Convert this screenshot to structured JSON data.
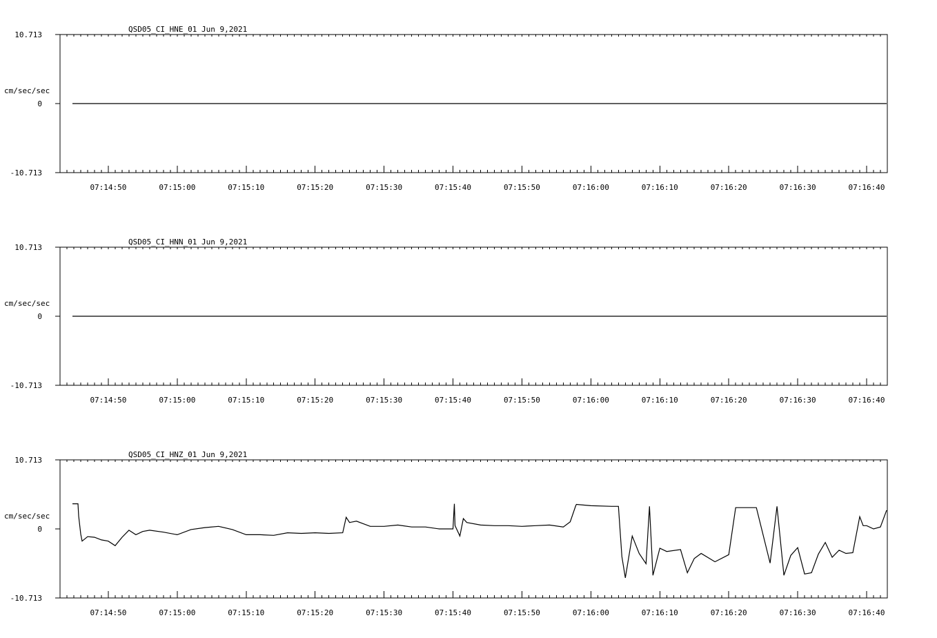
{
  "chart_data": [
    {
      "type": "line",
      "title": "QSD05_CI_HNE_01  Jun 9,2021",
      "ylabel": "cm/sec/sec",
      "ytick_labels": [
        "10.713",
        "0",
        "-10.713"
      ],
      "ylim": [
        -10.713,
        10.713
      ],
      "xlim": [
        "07:14:43",
        "07:16:43"
      ],
      "x_tick_labels": [
        "07:14:50",
        "07:15:00",
        "07:15:10",
        "07:15:20",
        "07:15:30",
        "07:15:40",
        "07:15:50",
        "07:16:00",
        "07:16:10",
        "07:16:20",
        "07:16:30",
        "07:16:40"
      ],
      "series": [
        {
          "x": [
            "07:14:44.8",
            "07:16:42.9"
          ],
          "y": [
            0,
            0
          ]
        }
      ]
    },
    {
      "type": "line",
      "title": "QSD05_CI_HNN_01  Jun 9,2021",
      "ylabel": "cm/sec/sec",
      "ytick_labels": [
        "10.713",
        "0",
        "-10.713"
      ],
      "ylim": [
        -10.713,
        10.713
      ],
      "xlim": [
        "07:14:43",
        "07:16:43"
      ],
      "x_tick_labels": [
        "07:14:50",
        "07:15:00",
        "07:15:10",
        "07:15:20",
        "07:15:30",
        "07:15:40",
        "07:15:50",
        "07:16:00",
        "07:16:10",
        "07:16:20",
        "07:16:30",
        "07:16:40"
      ],
      "series": [
        {
          "x": [
            "07:14:44.8",
            "07:15:30",
            "07:16:42.9"
          ],
          "y": [
            0,
            0,
            0
          ]
        }
      ]
    },
    {
      "type": "line",
      "title": "QSD05_CI_HNZ_01  Jun 9,2021",
      "ylabel": "cm/sec/sec",
      "ytick_labels": [
        "10.713",
        "0",
        "-10.713"
      ],
      "ylim": [
        -10.713,
        10.713
      ],
      "xlim": [
        "07:14:43",
        "07:16:43"
      ],
      "x_tick_labels": [
        "07:14:50",
        "07:15:00",
        "07:15:10",
        "07:15:20",
        "07:15:30",
        "07:15:40",
        "07:15:50",
        "07:16:00",
        "07:16:10",
        "07:16:20",
        "07:16:30",
        "07:16:40"
      ],
      "series": [
        {
          "x": [
            "07:14:44.8",
            "07:14:45.6",
            "07:14:45.7",
            "07:14:46",
            "07:14:46.2",
            "07:14:47",
            "07:14:48",
            "07:14:49",
            "07:14:50",
            "07:14:51",
            "07:14:52",
            "07:14:53",
            "07:14:54",
            "07:14:55",
            "07:14:56",
            "07:14:58",
            "07:15:00",
            "07:15:02",
            "07:15:04",
            "07:15:06",
            "07:15:08",
            "07:15:10",
            "07:15:12",
            "07:15:14",
            "07:15:16",
            "07:15:18",
            "07:15:20",
            "07:15:22",
            "07:15:24",
            "07:15:24.5",
            "07:15:25",
            "07:15:26",
            "07:15:28",
            "07:15:30",
            "07:15:32",
            "07:15:34",
            "07:15:36",
            "07:15:38",
            "07:15:40",
            "07:15:40.2",
            "07:15:40.3",
            "07:15:41",
            "07:15:41.5",
            "07:15:42",
            "07:15:44",
            "07:15:46",
            "07:15:48",
            "07:15:50",
            "07:15:52",
            "07:15:54",
            "07:15:56",
            "07:15:57",
            "07:15:57.8",
            "07:15:57.9",
            "07:16:00",
            "07:16:03",
            "07:16:04",
            "07:16:04.5",
            "07:16:05",
            "07:16:06",
            "07:16:07",
            "07:16:08",
            "07:16:08.5",
            "07:16:09",
            "07:16:10",
            "07:16:11",
            "07:16:13",
            "07:16:14",
            "07:16:15",
            "07:16:16",
            "07:16:18",
            "07:16:20",
            "07:16:21",
            "07:16:23",
            "07:16:24",
            "07:16:26",
            "07:16:27",
            "07:16:28",
            "07:16:29",
            "07:16:30",
            "07:16:31",
            "07:16:32",
            "07:16:33",
            "07:16:34",
            "07:16:35",
            "07:16:36",
            "07:16:37",
            "07:16:38",
            "07:16:39",
            "07:16:39.5",
            "07:16:40",
            "07:16:41",
            "07:16:42",
            "07:16:42.9"
          ],
          "y": [
            3.9,
            3.9,
            2.0,
            -0.8,
            -1.9,
            -1.2,
            -1.3,
            -1.7,
            -1.9,
            -2.6,
            -1.3,
            -0.2,
            -0.9,
            -0.4,
            -0.2,
            -0.5,
            -0.9,
            -0.1,
            0.2,
            0.4,
            -0.1,
            -0.9,
            -0.9,
            -1.0,
            -0.6,
            -0.7,
            -0.6,
            -0.7,
            -0.6,
            1.8,
            1.0,
            1.2,
            0.4,
            0.4,
            0.6,
            0.3,
            0.3,
            0.0,
            0.0,
            3.9,
            0.5,
            -1.1,
            1.6,
            1.0,
            0.6,
            0.5,
            0.5,
            0.4,
            0.5,
            0.6,
            0.3,
            1.1,
            3.6,
            3.8,
            3.6,
            3.5,
            3.5,
            -4.3,
            -7.6,
            -1.1,
            -3.8,
            -5.4,
            3.5,
            -7.2,
            -3.0,
            -3.5,
            -3.2,
            -6.8,
            -4.6,
            -3.8,
            -5.1,
            -4.0,
            3.3,
            3.3,
            3.3,
            -5.3,
            3.5,
            -7.2,
            -4.1,
            -2.9,
            -7.0,
            -6.8,
            -3.9,
            -2.1,
            -4.4,
            -3.3,
            -3.8,
            -3.7,
            1.9,
            0.5,
            0.5,
            0.0,
            0.3,
            2.9
          ]
        }
      ]
    }
  ]
}
